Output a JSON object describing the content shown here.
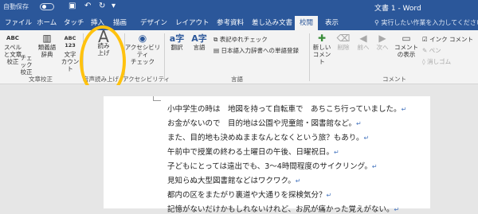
{
  "titlebar": {
    "autosave": "自動保存",
    "toggle_state": "オフ",
    "doc_title": "文書 1 - Word"
  },
  "tabs": [
    "ファイル",
    "ホーム",
    "タッチ",
    "挿入",
    "描画",
    "デザイン",
    "レイアウト",
    "参考資料",
    "差し込み文書",
    "校閲",
    "表示"
  ],
  "active_tab": "校閲",
  "tell_me": "実行したい作業を入力してください",
  "ribbon": {
    "spell": {
      "icon": "ABC",
      "label1": "スペル",
      "label2": "と文章校正"
    },
    "wordcount_check": {
      "label1": "チェック",
      "label2": "校正"
    },
    "thesaurus": {
      "label1": "類義語",
      "label2": "辞典"
    },
    "wordcount": {
      "icon": "ABC 123",
      "label1": "文字",
      "label2": "カウント"
    },
    "proofing_group": "文章校正",
    "read_aloud": {
      "icon": "A",
      "label1": "読み",
      "label2": "上げ"
    },
    "speech_group": "音声読み上げ",
    "accessibility": {
      "label1": "アクセシビリティ",
      "label2": "チェック"
    },
    "accessibility_group": "アクセシビリティ",
    "translate": "翻訳",
    "language": "言語",
    "furigana": "表記ゆれチェック",
    "dictionary": "日本語入力辞書への単語登録",
    "language_group": "言語",
    "new_comment": {
      "label1": "新しい",
      "label2": "コメント"
    },
    "delete": "削除",
    "previous": "前へ",
    "next": "次へ",
    "show_comments": {
      "label1": "コメント",
      "label2": "の表示"
    },
    "ink_comment": "インク コメント",
    "pen": "ペン",
    "eraser": "消しゴム",
    "comments_group": "コメント"
  },
  "document": {
    "lines": [
      "小中学生の時は　地図を持って自転車で　あちこち行っていました。",
      "お金がないので　目的地は公園や児童館・図書館など。",
      "また、目的地も決めぬままなんとなくという旅？もあり。",
      "午前中で授業の終わる土曜日の午後、日曜祝日。",
      "子どもにとっては遠出でも、3〜4時間程度のサイクリング。",
      "見知らぬ大型図書館などはワクワク。",
      "都内の区をまたがり裏道や大通りを探検気分？",
      "記憶がないだけかもしれないけれど、お尻が痛かった覚えがない。"
    ],
    "return_mark": "↵"
  },
  "colors": {
    "accent": "#2b579a",
    "highlight": "#ffc20e"
  }
}
